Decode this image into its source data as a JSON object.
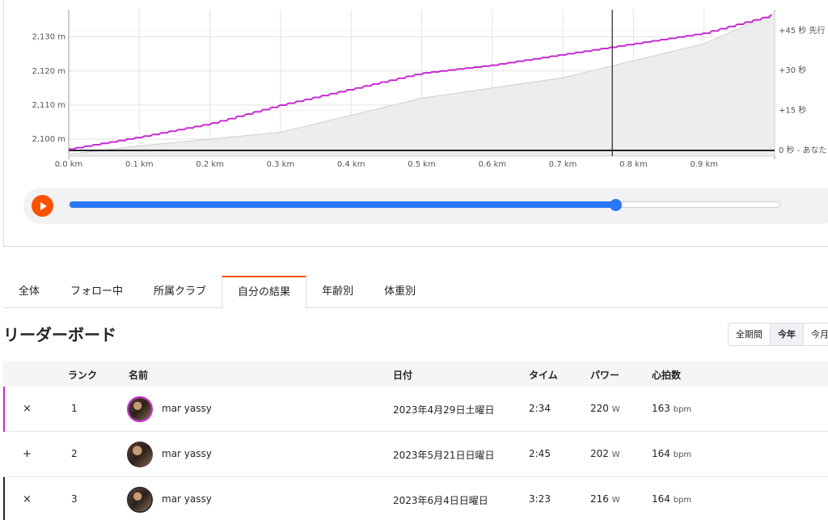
{
  "chart": {
    "y_left_ticks": [
      "2,130 m",
      "2,120 m",
      "2,110 m",
      "2,100 m"
    ],
    "y_right_ticks": [
      "+45 秒 先行",
      "+30 秒",
      "+15 秒",
      "0 秒 - あなた"
    ],
    "x_ticks": [
      "0.0 km",
      "0.1 km",
      "0.2 km",
      "0.3 km",
      "0.4 km",
      "0.5 km",
      "0.6 km",
      "0.7 km",
      "0.8 km",
      "0.9 km"
    ],
    "colors": {
      "lead_line": "#c62bd0",
      "elevation_fill": "#ededed",
      "cursor": "#222222"
    },
    "chart_data": {
      "type": "line",
      "x_unit": "km",
      "xlim": [
        0,
        1.0
      ],
      "series": [
        {
          "x": [
            0,
            0.1,
            0.2,
            0.3,
            0.4,
            0.5,
            0.6,
            0.7,
            0.8,
            0.9,
            1.0
          ],
          "values": [
            2095.5,
            2098,
            2100,
            2102,
            2107,
            2112,
            2115,
            2118,
            2123,
            2128,
            2137
          ]
        },
        {
          "x": [
            0,
            0.1,
            0.2,
            0.3,
            0.4,
            0.5,
            0.6,
            0.7,
            0.8,
            0.9,
            1.0
          ],
          "values": [
            0.5,
            5,
            10,
            17,
            23,
            29,
            32,
            36,
            40,
            44,
            51
          ]
        }
      ],
      "ylim_left": [
        2095,
        2138
      ],
      "ylim_right": [
        0,
        51
      ],
      "cursor_x": 0.77
    }
  },
  "player": {
    "progress": 0.769,
    "play_icon": "play-icon"
  },
  "tabs": [
    {
      "label": "全体",
      "active": false
    },
    {
      "label": "フォロー中",
      "active": false
    },
    {
      "label": "所属クラブ",
      "active": false
    },
    {
      "label": "自分の結果",
      "active": true
    },
    {
      "label": "年齢別",
      "active": false
    },
    {
      "label": "体重別",
      "active": false
    }
  ],
  "leaderboard": {
    "title": "リーダーボード",
    "filters": [
      "全期間",
      "今年",
      "今月"
    ],
    "active_filter": "今年",
    "headers": {
      "rank": "ランク",
      "name": "名前",
      "date": "日付",
      "time": "タイム",
      "power": "パワー",
      "hr": "心拍数"
    },
    "rows": [
      {
        "toggle": "×",
        "rank": "1",
        "name": "mar yassy",
        "date": "2023年4月29日土曜日",
        "time": "2:34",
        "power": "220",
        "power_unit": "W",
        "hr": "163",
        "hr_unit": "bpm",
        "marker": "#c62bd0"
      },
      {
        "toggle": "+",
        "rank": "2",
        "name": "mar yassy",
        "date": "2023年5月21日日曜日",
        "time": "2:45",
        "power": "202",
        "power_unit": "W",
        "hr": "164",
        "hr_unit": "bpm",
        "marker": ""
      },
      {
        "toggle": "×",
        "rank": "3",
        "name": "mar yassy",
        "date": "2023年6月4日日曜日",
        "time": "3:23",
        "power": "216",
        "power_unit": "W",
        "hr": "164",
        "hr_unit": "bpm",
        "marker": "#242428"
      }
    ]
  }
}
